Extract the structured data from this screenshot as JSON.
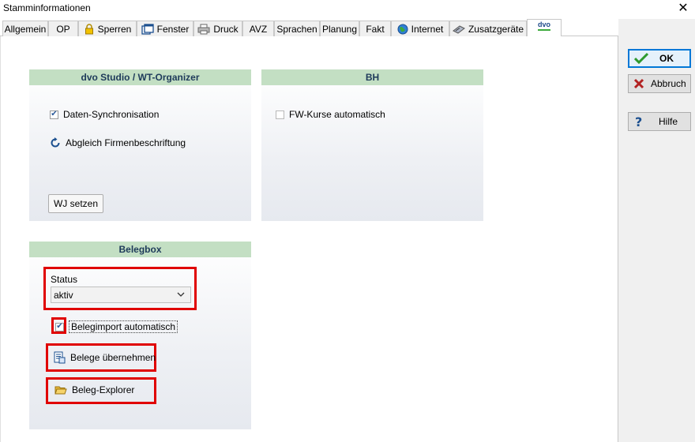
{
  "window": {
    "title": "Stamminformationen",
    "close_glyph": "✕"
  },
  "tabs": [
    {
      "label": "Allgemein",
      "icon": null
    },
    {
      "label": "OP",
      "icon": null
    },
    {
      "label": "Sperren",
      "icon": "lock-icon"
    },
    {
      "label": "Fenster",
      "icon": "window-icon"
    },
    {
      "label": "Druck",
      "icon": "printer-icon"
    },
    {
      "label": "AVZ",
      "icon": null
    },
    {
      "label": "Sprachen",
      "icon": null
    },
    {
      "label": "Planung",
      "icon": null
    },
    {
      "label": "Fakt",
      "icon": null
    },
    {
      "label": "Internet",
      "icon": "globe-icon"
    },
    {
      "label": "Zusatzgeräte",
      "icon": "device-icon"
    },
    {
      "label": "",
      "icon": "dvo-logo-icon",
      "active": true,
      "logo_text": "dvo"
    }
  ],
  "sidebar": {
    "ok_label": "OK",
    "cancel_label": "Abbruch",
    "help_label": "Hilfe"
  },
  "panels": {
    "dvo": {
      "title": "dvo Studio / WT-Organizer",
      "sync_label": "Daten-Synchronisation",
      "sync_checked": true,
      "abgleich_label": "Abgleich Firmenbeschriftung",
      "wj_button": "WJ setzen"
    },
    "bh": {
      "title": "BH",
      "fw_label": "FW-Kurse automatisch",
      "fw_checked": false
    },
    "belegbox": {
      "title": "Belegbox",
      "status_label": "Status",
      "status_value": "aktiv",
      "import_label": "Belegimport automatisch",
      "import_checked": true,
      "uebernehmen_label": "Belege übernehmen",
      "explorer_label": "Beleg-Explorer"
    }
  },
  "colors": {
    "panel_header_bg": "#c3dfc3",
    "panel_header_text": "#1e3a5a",
    "highlight_red": "#e00000",
    "ok_border": "#0078d7"
  }
}
